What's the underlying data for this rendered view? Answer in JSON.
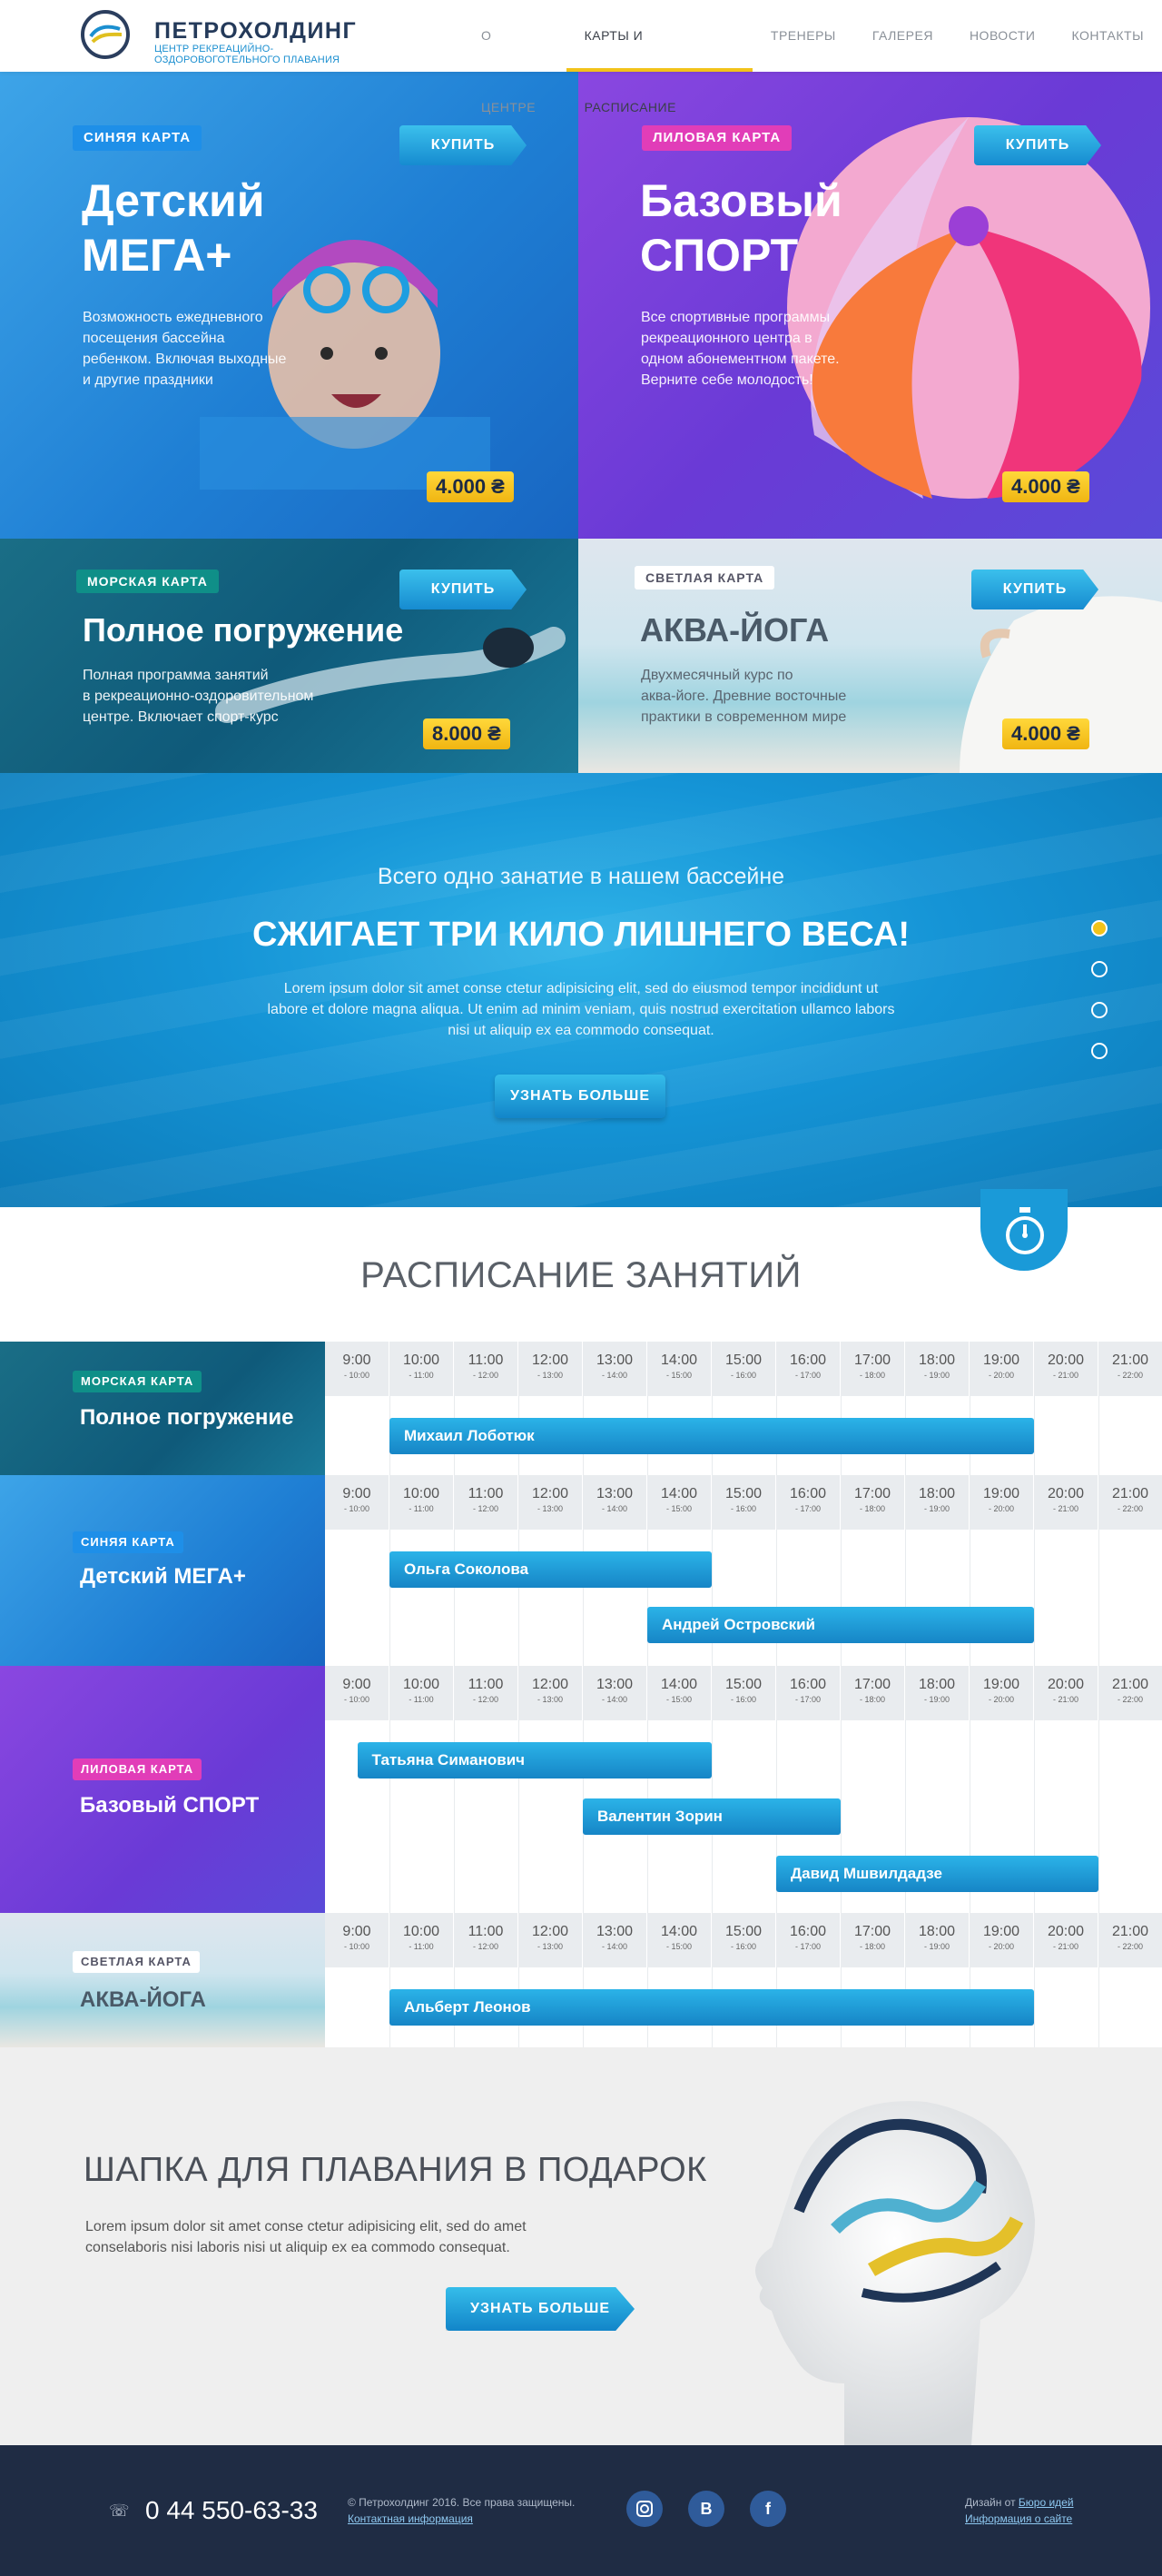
{
  "header": {
    "logo_title": "ПЕТРОХОЛДИНГ",
    "logo_subtitle": "центр рекреацийно-оздоровоготельного плавания",
    "nav": [
      {
        "label": "О центре"
      },
      {
        "label": "Карты и расписание",
        "active": true
      },
      {
        "label": "Тренеры"
      },
      {
        "label": "Галерея"
      },
      {
        "label": "Новости"
      },
      {
        "label": "Контакты"
      }
    ]
  },
  "cards": [
    {
      "tag": "Синяя карта",
      "title_line1": "Детский",
      "title_line2": "МЕГА+",
      "desc": [
        "Возможность ежедневного",
        "посещения бассейна",
        "ребенком. Включая выходные",
        "и другие праздники"
      ],
      "buy": "КУПИТЬ",
      "price": "4.000 ₴",
      "tag_color": "#1e8fe8"
    },
    {
      "tag": "Лиловая карта",
      "title_line1": "Базовый",
      "title_line2": "СПОРТ",
      "desc": [
        "Все спортивные программы",
        "рекреационного центра в",
        "одном абонементном пакете.",
        "Верните себе молодость!"
      ],
      "buy": "КУПИТЬ",
      "price": "4.000 ₴",
      "tag_color": "#e13db8"
    },
    {
      "tag": "Морская карта",
      "title_line1": "Полное погружение",
      "desc": [
        "Полная программа занятий",
        "в рекреационно-оздоровительном",
        "центре. Включает спорт-курс"
      ],
      "buy": "КУПИТЬ",
      "price": "8.000 ₴",
      "tag_color": "#0f8f88"
    },
    {
      "tag": "Светлая карта",
      "title_line1": "АКВА-ЙОГА",
      "desc": [
        "Двухмесячный курс по",
        "аква-йоге. Древние восточные",
        "практики в современном мире"
      ],
      "buy": "КУПИТЬ",
      "price": "4.000 ₴",
      "tag_color": "#ffffff"
    }
  ],
  "hero": {
    "small": "Всего одно занатие в нашем бассейне",
    "big": "СЖИГАЕТ ТРИ КИЛО ЛИШНЕГО ВЕСА!",
    "text": "Lorem ipsum dolor sit amet conse ctetur adipisicing elit, sed do eiusmod tempor incididunt ut labore et dolore magna aliqua. Ut enim ad minim veniam, quis nostrud exercitation ullamco labors nisi ut aliquip ex ea commodo consequat.",
    "button": "УЗНАТЬ БОЛЬШЕ",
    "slides": 4,
    "active_slide": 1
  },
  "schedule": {
    "title": "РАСПИСАНИЕ ЗАНЯТИЙ",
    "times": [
      "9:00",
      "10:00",
      "11:00",
      "12:00",
      "13:00",
      "14:00",
      "15:00",
      "16:00",
      "17:00",
      "18:00",
      "19:00",
      "20:00",
      "21:00"
    ],
    "ends": [
      "- 10:00",
      "- 11:00",
      "- 12:00",
      "- 13:00",
      "- 14:00",
      "- 15:00",
      "- 16:00",
      "- 17:00",
      "- 18:00",
      "- 19:00",
      "- 20:00",
      "- 21:00",
      "- 22:00"
    ],
    "rows": [
      {
        "tag": "Морская карта",
        "name": "Полное погружение",
        "tag_color": "#0f8f88",
        "sessions": [
          {
            "trainer": "Михаил Лоботюк",
            "start": "10:00",
            "end": "20:00"
          }
        ]
      },
      {
        "tag": "Синяя карта",
        "name": "Детский МЕГА+",
        "tag_color": "#1e8fe8",
        "sessions": [
          {
            "trainer": "Ольга Соколова",
            "start": "10:00",
            "end": "15:00"
          },
          {
            "trainer": "Андрей Островский",
            "start": "14:00",
            "end": "20:00"
          }
        ]
      },
      {
        "tag": "Лиловая карта",
        "name": "Базовый СПОРТ",
        "tag_color": "#e13db8",
        "sessions": [
          {
            "trainer": "Татьяна Симанович",
            "start": "9:30",
            "end": "15:00"
          },
          {
            "trainer": "Валентин Зорин",
            "start": "13:00",
            "end": "17:00"
          },
          {
            "trainer": "Давид Мшвилдадзе",
            "start": "16:00",
            "end": "21:00"
          }
        ]
      },
      {
        "tag": "Светлая карта",
        "name": "АКВА-ЙОГА",
        "tag_color": "#ffffff",
        "sessions": [
          {
            "trainer": "Альберт Леонов",
            "start": "10:00",
            "end": "20:00"
          }
        ]
      }
    ]
  },
  "gift": {
    "title": "ШАПКА ДЛЯ ПЛАВАНИЯ В ПОДАРОК",
    "text": "Lorem ipsum dolor sit amet conse ctetur adipisicing elit, sed do amet conselaboris nisi laboris nisi ut aliquip ex ea commodo consequat.",
    "button": "УЗНАТЬ БОЛЬШЕ"
  },
  "footer": {
    "phone": "0 44 550-63-33",
    "copyright": "© Петрохолдинг 2016. Все права защищены.",
    "contact_link": "Контактная информация",
    "designer_prefix": "Дизайн от",
    "designer_link": "Бюро идей",
    "site_info": "Информация о сайте",
    "social": [
      {
        "icon": "instagram-icon"
      },
      {
        "icon": "vk-icon",
        "label": "B"
      },
      {
        "icon": "facebook-icon",
        "label": "f"
      }
    ]
  },
  "colors": {
    "accent_yellow": "#f2c31a",
    "accent_blue": "#1a9ad8",
    "footer_bg": "#1f2c44"
  }
}
